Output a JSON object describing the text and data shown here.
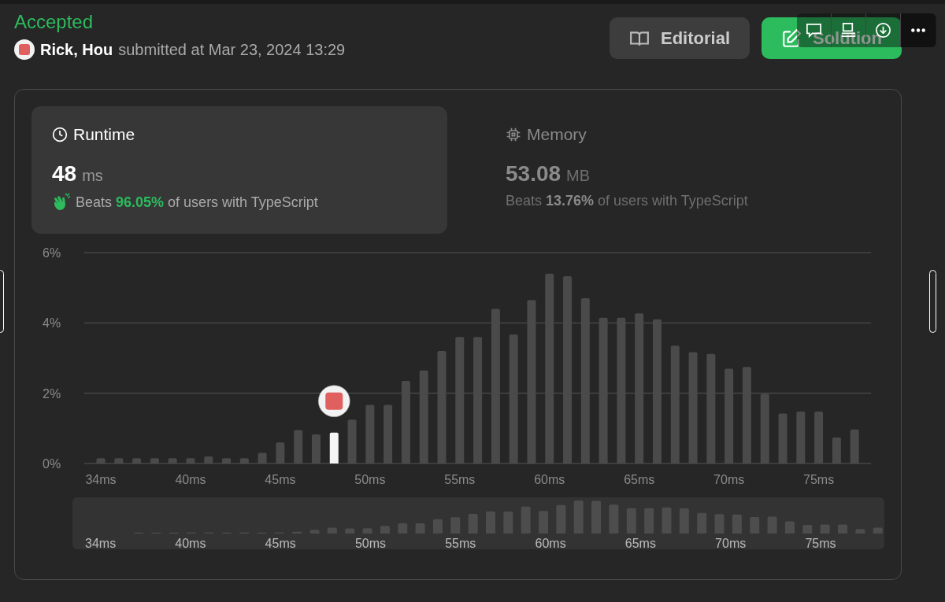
{
  "status": "Accepted",
  "submission": {
    "user": "Rick, Hou",
    "submitted": "submitted at Mar 23, 2024 13:29"
  },
  "actions": [
    {
      "kind": "editorial",
      "label": "Editorial"
    },
    {
      "kind": "solution",
      "label": "Solution"
    }
  ],
  "stats": [
    {
      "kind": "runtime",
      "label": "Runtime",
      "value": "48",
      "unit": "ms",
      "beats": "Beats **96.05%** of users with TypeScript",
      "selected": true
    },
    {
      "kind": "memory",
      "label": "Memory",
      "value": "53.08",
      "unit": "MB",
      "beats": "Beats **13.76%** of users with TypeScript",
      "selected": false
    }
  ],
  "chart": {
    "chart_data": {
      "type": "bar",
      "categories": [
        "34ms",
        null,
        null,
        null,
        null,
        "40ms",
        null,
        null,
        null,
        null,
        "45ms",
        null,
        null,
        null,
        null,
        "50ms",
        null,
        null,
        null,
        null,
        "55ms",
        null,
        null,
        null,
        null,
        "60ms",
        null,
        null,
        null,
        null,
        "65ms",
        null,
        null,
        null,
        null,
        "70ms",
        null,
        null,
        null,
        null,
        "75ms",
        null,
        null
      ],
      "series": [
        {
          "color": "#4a4a4a",
          "values": [
            0.15,
            0.15,
            0.15,
            0.15,
            0.15,
            0.15,
            0.2,
            0.15,
            0.15,
            0.3,
            0.6,
            0.95,
            0.83,
            null,
            1.25,
            1.67,
            1.67,
            2.35,
            2.65,
            3.2,
            3.6,
            3.6,
            4.4,
            3.67,
            4.65,
            5.4,
            5.33,
            4.7,
            4.15,
            4.15,
            4.27,
            4.1,
            3.35,
            3.17,
            3.12,
            2.7,
            2.75,
            1.98,
            1.42,
            1.48,
            1.48,
            0.74,
            0.97
          ]
        },
        {
          "color": "#f5f5f5",
          "values": [
            null,
            null,
            null,
            null,
            null,
            null,
            null,
            null,
            null,
            null,
            null,
            null,
            null,
            0.88,
            null,
            null,
            null,
            null,
            null,
            null,
            null,
            null,
            null,
            null,
            null,
            null,
            null,
            null,
            null,
            null,
            null,
            null,
            null,
            null,
            null,
            null,
            null,
            null,
            null,
            null,
            null,
            null,
            null
          ]
        }
      ],
      "ylim": [
        0,
        6
      ],
      "yticks": [
        {
          "value": 0,
          "label": "0%"
        },
        {
          "value": 2,
          "label": "2%"
        },
        {
          "value": 4,
          "label": "4%"
        },
        {
          "value": 6,
          "label": "6%"
        }
      ]
    }
  },
  "overview": {
    "labels": [
      "34ms",
      "40ms",
      "45ms",
      "50ms",
      "55ms",
      "60ms",
      "65ms",
      "70ms",
      "75ms"
    ]
  }
}
